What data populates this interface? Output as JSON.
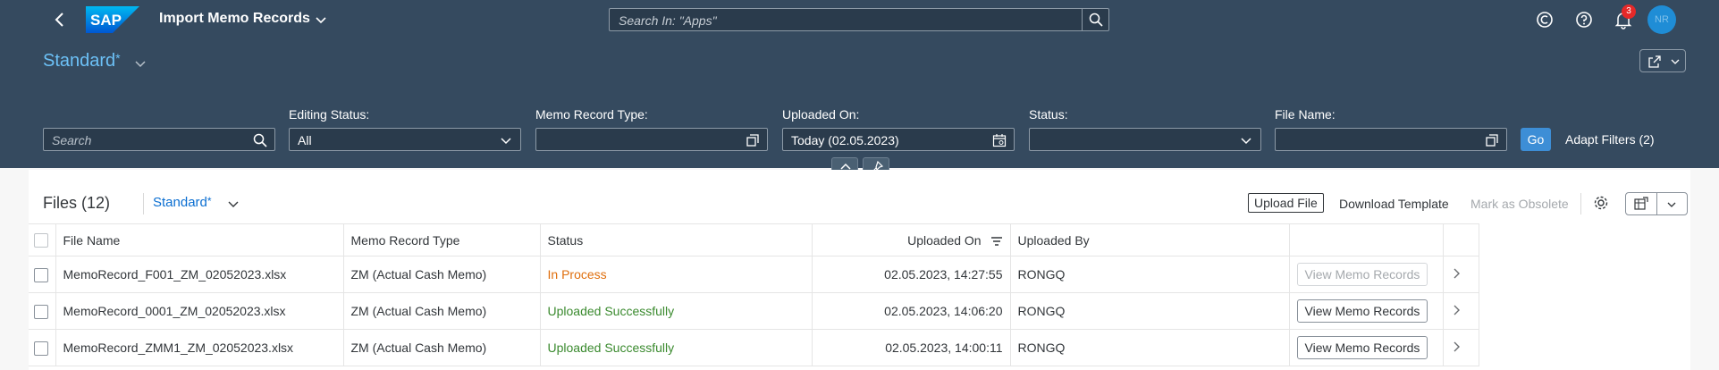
{
  "shell": {
    "app_title": "Import Memo Records",
    "logo_text": "SAP",
    "search_placeholder": "Search In: \"Apps\"",
    "notification_count": "3",
    "avatar_initials": "NR"
  },
  "filterbar": {
    "variant": "Standard",
    "variant_modified": "*",
    "search_placeholder": "Search",
    "filters": [
      {
        "label": "Editing Status:",
        "value": ""
      },
      {
        "label": "Memo Record Type:",
        "value": ""
      },
      {
        "label": "Uploaded On:",
        "value": "Today (02.05.2023)"
      },
      {
        "label": "Status:",
        "value": ""
      },
      {
        "label": "File Name:",
        "value": ""
      }
    ],
    "editing_status_value": "All",
    "go_label": "Go",
    "adapt_filters_label": "Adapt Filters (2)"
  },
  "table": {
    "title": "Files (12)",
    "variant": "Standard",
    "variant_modified": "*",
    "upload_label": "Upload File",
    "download_label": "Download Template",
    "obsolete_label": "Mark as Obsolete",
    "columns": [
      "File Name",
      "Memo Record Type",
      "Status",
      "Uploaded On",
      "Uploaded By"
    ],
    "rows": [
      {
        "file_name": "MemoRecord_F001_ZM_02052023.xlsx",
        "type": "ZM (Actual Cash Memo)",
        "status": "In Process",
        "status_kind": "process",
        "uploaded_on": "02.05.2023, 14:27:55",
        "uploaded_by": "RONGQ",
        "action": "View Memo Records",
        "action_enabled": false
      },
      {
        "file_name": "MemoRecord_0001_ZM_02052023.xlsx",
        "type": "ZM (Actual Cash Memo)",
        "status": "Uploaded Successfully",
        "status_kind": "success",
        "uploaded_on": "02.05.2023, 14:06:20",
        "uploaded_by": "RONGQ",
        "action": "View Memo Records",
        "action_enabled": true
      },
      {
        "file_name": "MemoRecord_ZMM1_ZM_02052023.xlsx",
        "type": "ZM (Actual Cash Memo)",
        "status": "Uploaded Successfully",
        "status_kind": "success",
        "uploaded_on": "02.05.2023, 14:00:11",
        "uploaded_by": "RONGQ",
        "action": "View Memo Records",
        "action_enabled": true
      }
    ]
  },
  "colors": {
    "shell_bg": "#354a5f",
    "accent": "#0a6ed1",
    "in_process": "#df6e0c",
    "success": "#3a8a2e"
  }
}
